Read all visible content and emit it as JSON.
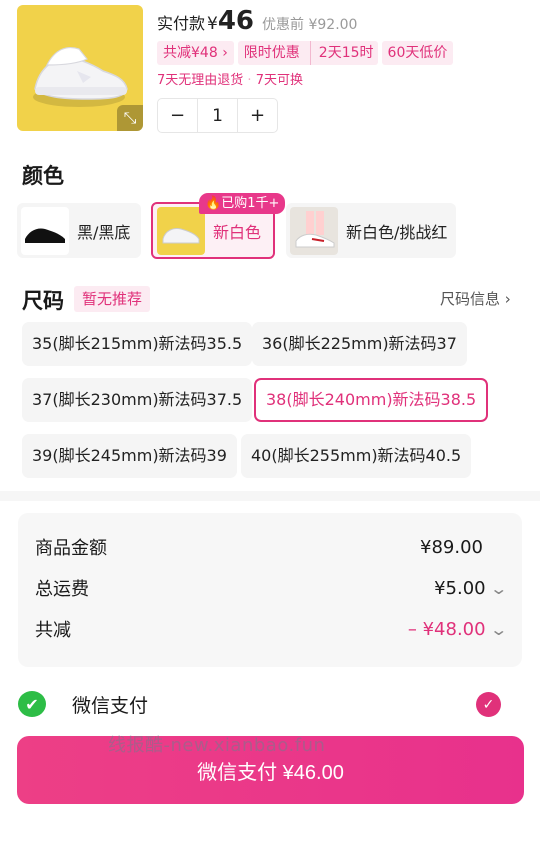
{
  "product": {
    "pay_label": "实付款",
    "currency": "¥",
    "pay_price": "46",
    "original_price": "优惠前 ¥92.00",
    "tags": [
      "共减¥48",
      "限时优惠",
      "2天15时",
      "60天低价"
    ],
    "return_policy": "7天无理由退货",
    "exchange_policy": "7天可换",
    "quantity": "1",
    "minus_label": "−",
    "plus_label": "+"
  },
  "color": {
    "title": "颜色",
    "badge": "已购1千+",
    "options": [
      {
        "label": "黑/黑底",
        "selected": false
      },
      {
        "label": "新白色",
        "selected": true
      },
      {
        "label": "新白色/挑战红",
        "selected": false
      }
    ]
  },
  "size": {
    "title": "尺码",
    "recommend_tag": "暂无推荐",
    "info_link": "尺码信息",
    "options": [
      "35(脚长215mm)新法码35.5",
      "36(脚长225mm)新法码37",
      "37(脚长230mm)新法码37.5",
      "38(脚长240mm)新法码38.5",
      "39(脚长245mm)新法码39",
      "40(脚长255mm)新法码40.5"
    ],
    "selected": "38(脚长240mm)新法码38.5"
  },
  "summary": {
    "goods_label": "商品金额",
    "goods_value": "¥89.00",
    "shipping_label": "总运费",
    "shipping_value": "¥5.00",
    "discount_label": "共减",
    "discount_value": "– ¥48.00"
  },
  "payment": {
    "method": "微信支付",
    "button_label": "微信支付 ¥46.00"
  },
  "watermark": "线报酷-new.xianbao.fun",
  "colors": {
    "accent": "#e0317a",
    "button": "#ec3c88",
    "wechat": "#2dbd46",
    "product_bg": "#f1d24a"
  },
  "icons": [
    "expand-icon",
    "check-icon",
    "wechat-icon",
    "chevron-down-icon",
    "chevron-right-icon",
    "fire-icon"
  ]
}
